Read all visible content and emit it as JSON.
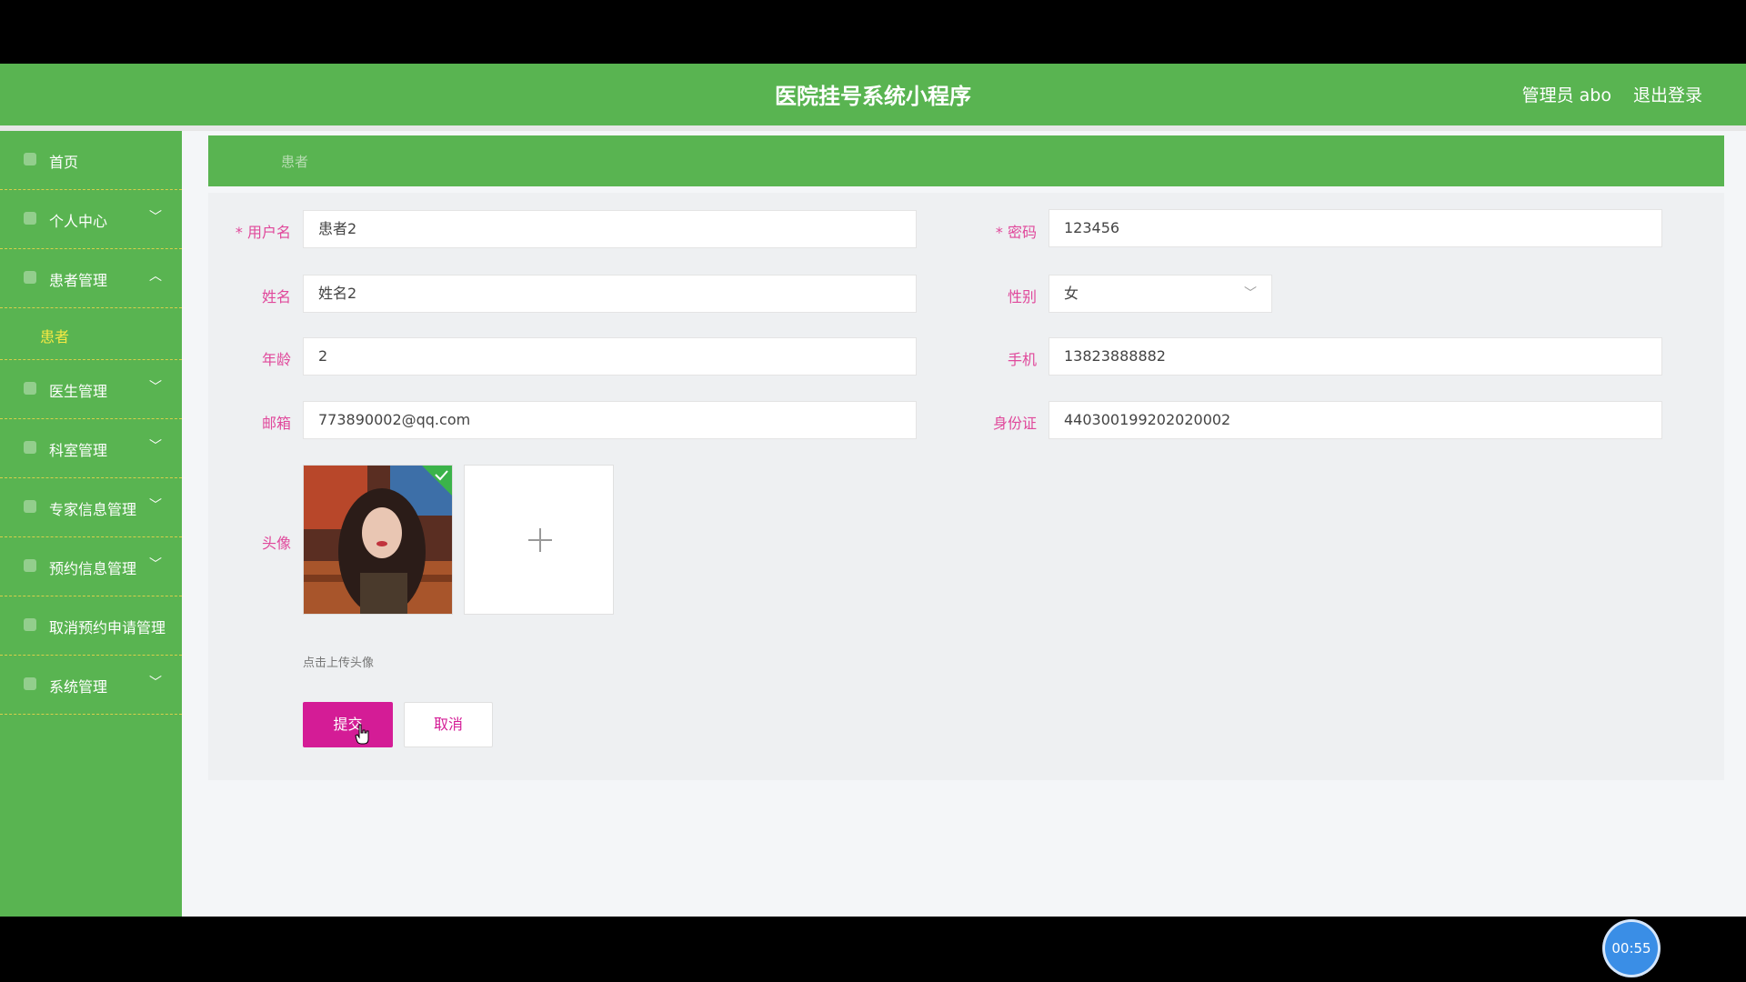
{
  "header": {
    "title": "医院挂号系统小程序",
    "user": "管理员 abo",
    "logout": "退出登录"
  },
  "sidebar": {
    "items": [
      {
        "label": "首页"
      },
      {
        "label": "个人中心"
      },
      {
        "label": "患者管理"
      },
      {
        "label": "患者"
      },
      {
        "label": "医生管理"
      },
      {
        "label": "科室管理"
      },
      {
        "label": "专家信息管理"
      },
      {
        "label": "预约信息管理"
      },
      {
        "label": "取消预约申请管理"
      },
      {
        "label": "系统管理"
      }
    ]
  },
  "breadcrumb": {
    "current": "患者"
  },
  "form": {
    "username": {
      "label": "用户名",
      "value": "患者2"
    },
    "password": {
      "label": "密码",
      "value": "123456"
    },
    "name": {
      "label": "姓名",
      "value": "姓名2"
    },
    "gender": {
      "label": "性别",
      "value": "女"
    },
    "age": {
      "label": "年龄",
      "value": "2"
    },
    "phone": {
      "label": "手机",
      "value": "13823888882"
    },
    "email": {
      "label": "邮箱",
      "value": "773890002@qq.com"
    },
    "idcard": {
      "label": "身份证",
      "value": "440300199202020002"
    },
    "avatar": {
      "label": "头像",
      "hint": "点击上传头像"
    },
    "submit": "提交",
    "cancel": "取消"
  },
  "timer": "00:55"
}
